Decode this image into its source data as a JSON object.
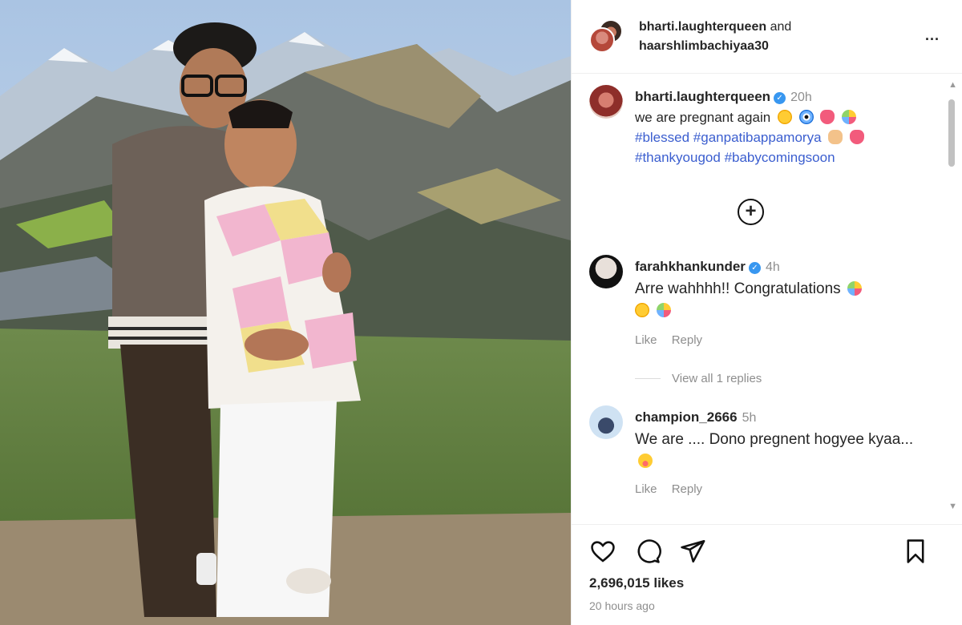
{
  "header": {
    "user1": "bharti.laughterqueen",
    "and": "and",
    "user2": "haarshlimbachiyaa30",
    "more": "..."
  },
  "caption": {
    "username": "bharti.laughterqueen",
    "time": "20h",
    "text": "we are pregnant again",
    "hashtag1": "#blessed",
    "hashtag2": "#ganpatibappamorya",
    "hashtag3": "#thankyougod",
    "hashtag4": "#babycomingsoon"
  },
  "load_more": "+",
  "comments": [
    {
      "username": "farahkhankunder",
      "time": "4h",
      "text": "Arre wahhhh!! Congratulations",
      "like": "Like",
      "reply": "Reply",
      "verified": true
    },
    {
      "username": "champion_2666",
      "time": "5h",
      "text": "We are .... Dono pregnent hogyee kyaa...",
      "like": "Like",
      "reply": "Reply",
      "verified": false
    }
  ],
  "view_replies": "View all 1 replies",
  "footer": {
    "likes": "2,696,015 likes",
    "time_ago": "20 hours ago"
  },
  "icons": [
    "heart-icon",
    "comment-icon",
    "share-icon",
    "bookmark-icon",
    "verified-icon",
    "add-circle-icon"
  ],
  "colors": {
    "hashtag": "#3b5ecf",
    "verified": "#3897f0",
    "muted": "#8e8e8e"
  }
}
